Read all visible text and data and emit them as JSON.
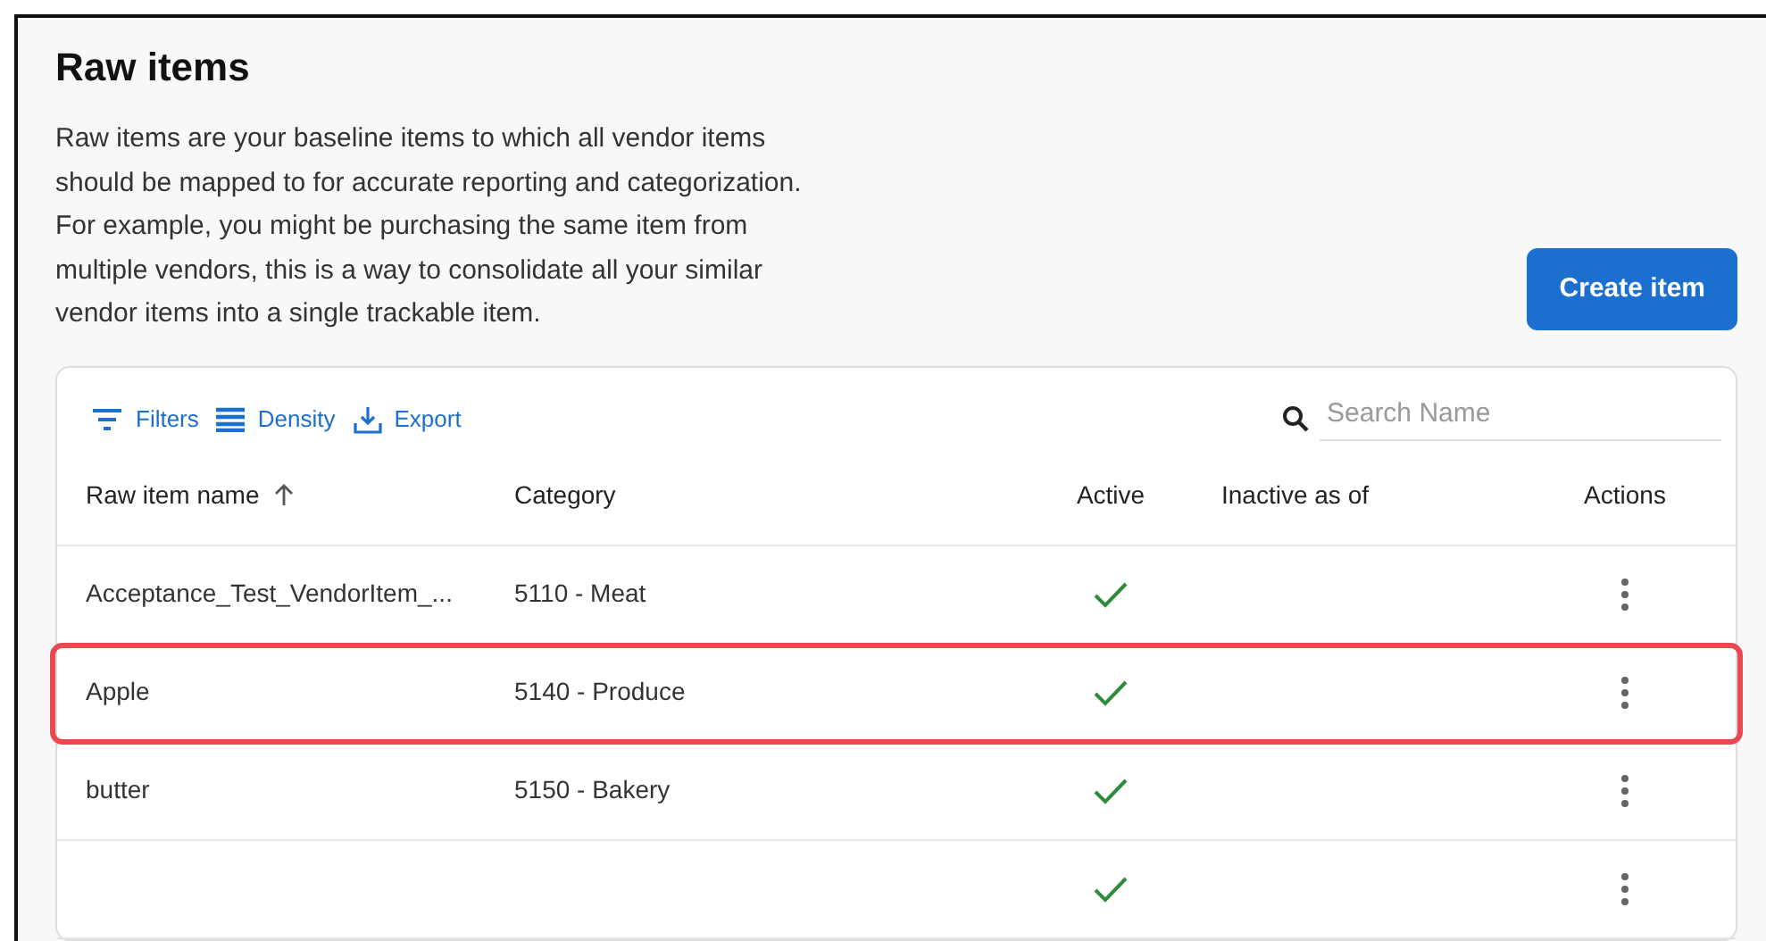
{
  "page": {
    "title": "Raw items",
    "description": "Raw items are your baseline items to which all vendor items should be mapped to for accurate reporting and categorization. For example, you might be purchasing the same item from multiple vendors, this is a way to consolidate all your similar vendor items into a single trackable item.",
    "create_button": "Create item"
  },
  "toolbar": [
    {
      "kind": "filter",
      "label": "Filters"
    },
    {
      "kind": "density",
      "label": "Density"
    },
    {
      "kind": "export",
      "label": "Export"
    }
  ],
  "search": {
    "placeholder": "Search Name"
  },
  "table": {
    "columns": [
      {
        "label": "Raw item name",
        "sorted": true
      },
      {
        "label": "Category",
        "sorted": false
      },
      {
        "label": "Active",
        "sorted": false
      },
      {
        "label": "Inactive as of",
        "sorted": false
      },
      {
        "label": "Actions",
        "sorted": false
      }
    ],
    "rows": [
      {
        "name": "Acceptance_Test_VendorItem_...",
        "category": "5110 - Meat",
        "active": true,
        "highlighted": false
      },
      {
        "name": "Apple",
        "category": "5140 - Produce",
        "active": true,
        "highlighted": true
      },
      {
        "name": "butter",
        "category": "5150 - Bakery",
        "active": true,
        "highlighted": false
      },
      {
        "active": true,
        "highlighted": false
      }
    ]
  }
}
